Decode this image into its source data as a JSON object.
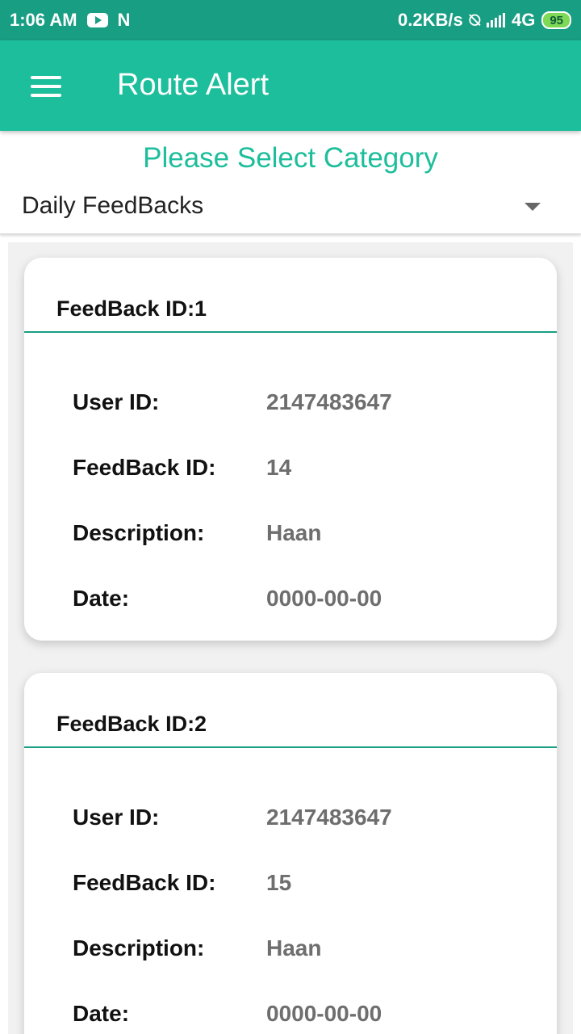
{
  "status": {
    "time": "1:06 AM",
    "net_speed": "0.2KB/s",
    "network": "4G",
    "battery": "95"
  },
  "appbar": {
    "title": "Route Alert"
  },
  "category": {
    "prompt": "Please Select Category",
    "selected": "Daily FeedBacks"
  },
  "labels": {
    "user_id": "User ID:",
    "feedback_id": "FeedBack ID:",
    "description": "Description:",
    "date": "Date:"
  },
  "cards": [
    {
      "title": "FeedBack ID:1",
      "user_id": "2147483647",
      "feedback_id": "14",
      "description": "Haan",
      "date": "0000-00-00"
    },
    {
      "title": "FeedBack ID:2",
      "user_id": "2147483647",
      "feedback_id": "15",
      "description": "Haan",
      "date": "0000-00-00"
    }
  ],
  "colors": {
    "primary": "#1dbe9b",
    "primary_dark": "#189e83"
  }
}
